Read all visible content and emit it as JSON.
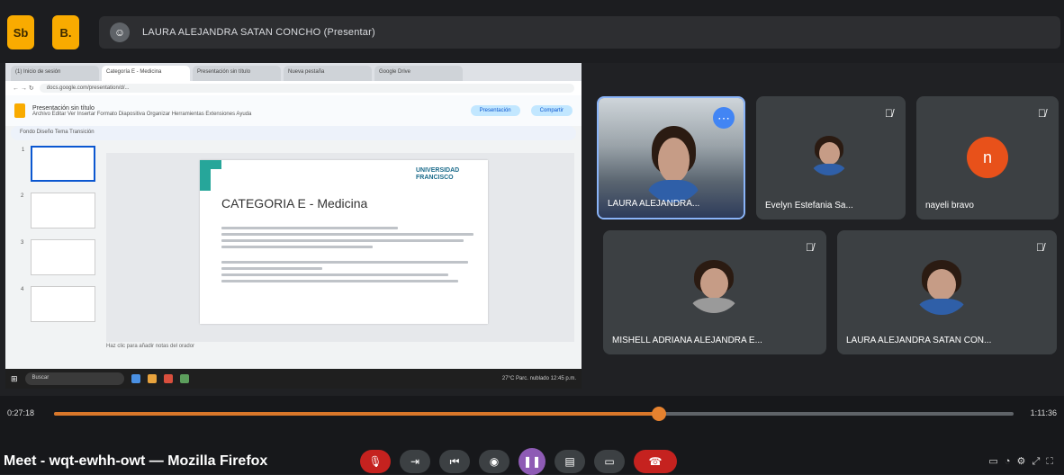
{
  "meet": {
    "top_buttons": [
      "Sb",
      "B."
    ],
    "presenting_text": "LAURA ALEJANDRA SATAN CONCHO (Presentar)"
  },
  "shared_screen": {
    "tabs": [
      "(1) Inicio de sesión",
      "Categoría E - Medicina",
      "Presentación sin título",
      "Nueva pestaña",
      "Google Drive"
    ],
    "url": "docs.google.com/presentation/d/...",
    "doc_title": "Presentación sin título",
    "menu": "Archivo  Editar  Ver  Insertar  Formato  Diapositiva  Organizar  Herramientas  Extensiones  Ayuda",
    "share_label": "Compartir",
    "slideshow_label": "Presentación",
    "toolbar_text": "Fondo  Diseño  Tema  Transición",
    "slide": {
      "brand": "UNIVERSIDAD FRANCISCO",
      "title": "CATEGORIA E - Medicina"
    },
    "notes": "Haz clic para añadir notas del orador",
    "taskbar_search": "Buscar",
    "taskbar_tray": "27°C Parc. nublado   12:45 p.m."
  },
  "participants": [
    {
      "name": "LAURA ALEJANDRA...",
      "active": true
    },
    {
      "name": "Evelyn Estefania Sa..."
    },
    {
      "name": "nayeli bravo",
      "initial": "n"
    },
    {
      "name": "MISHELL ADRIANA ALEJANDRA E..."
    },
    {
      "name": "LAURA ALEJANDRA SATAN CON..."
    }
  ],
  "player": {
    "current_time": "0:27:18",
    "total_time": "1:11:36",
    "progress": 0.63,
    "window_title": "Meet - wqt-ewhh-owt — Mozilla Firefox"
  },
  "colors": {
    "accent": "#8ab4f8",
    "progress": "#d9772a",
    "avatar_orange": "#e8511a",
    "docs_yellow": "#f9ab00"
  }
}
